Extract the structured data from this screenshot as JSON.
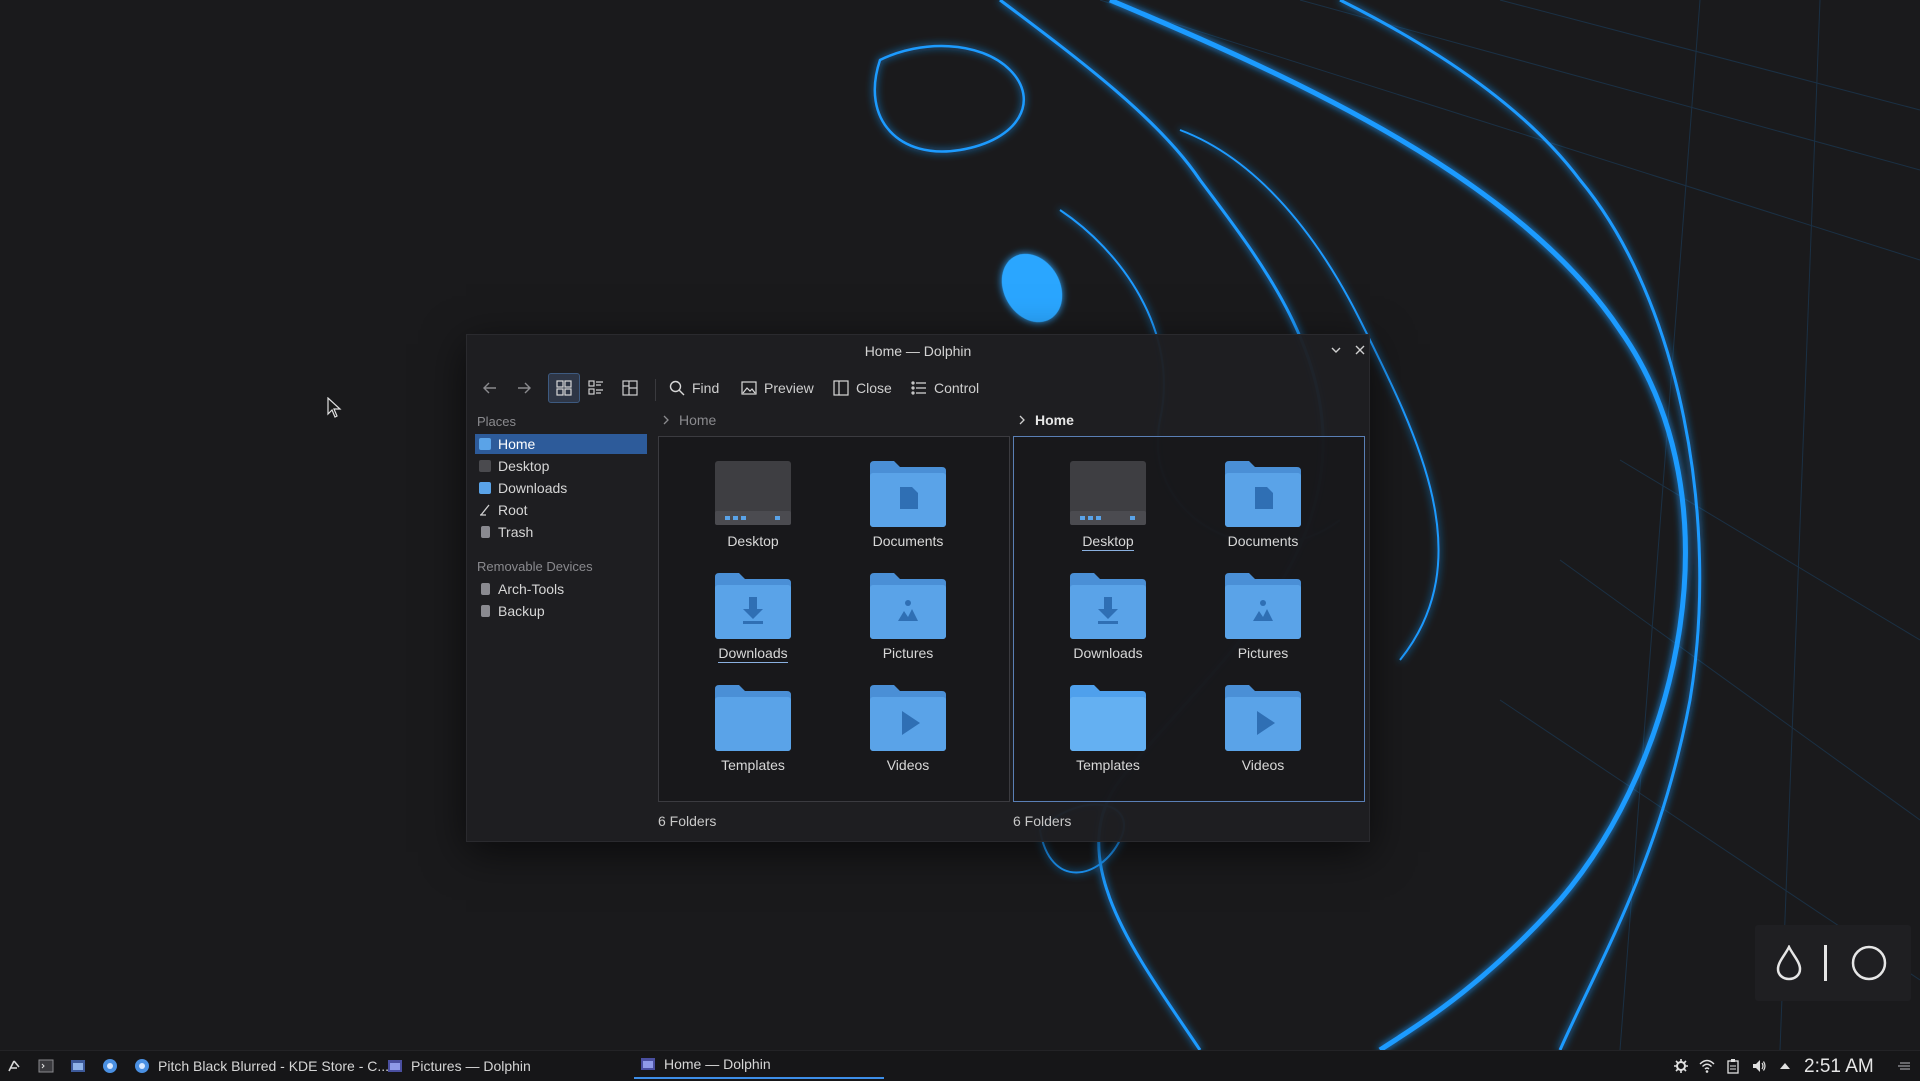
{
  "window": {
    "title": "Home — Dolphin",
    "controls": [
      "minimize-chevron",
      "close"
    ]
  },
  "toolbar": {
    "back_icon": "arrow-left",
    "forward_icon": "arrow-right",
    "view_modes": [
      "icons",
      "details",
      "compact"
    ],
    "active_view": "icons",
    "find_label": "Find",
    "preview_label": "Preview",
    "close_label": "Close",
    "control_label": "Control"
  },
  "sidebar": {
    "places_header": "Places",
    "places": [
      {
        "label": "Home",
        "icon": "home-folder",
        "active": true
      },
      {
        "label": "Desktop",
        "icon": "desktop"
      },
      {
        "label": "Downloads",
        "icon": "downloads-folder"
      },
      {
        "label": "Root",
        "icon": "root-slash"
      },
      {
        "label": "Trash",
        "icon": "trash"
      }
    ],
    "removable_header": "Removable Devices",
    "removable": [
      {
        "label": "Arch-Tools",
        "icon": "drive"
      },
      {
        "label": "Backup",
        "icon": "drive"
      }
    ]
  },
  "left_pane": {
    "breadcrumb": "Home",
    "items": [
      {
        "label": "Desktop",
        "icon": "desktop-folder"
      },
      {
        "label": "Documents",
        "icon": "documents-folder"
      },
      {
        "label": "Downloads",
        "icon": "downloads-folder",
        "underlined": true
      },
      {
        "label": "Pictures",
        "icon": "pictures-folder"
      },
      {
        "label": "Templates",
        "icon": "templates-folder"
      },
      {
        "label": "Videos",
        "icon": "videos-folder"
      }
    ],
    "status": "6 Folders"
  },
  "right_pane": {
    "breadcrumb": "Home",
    "items": [
      {
        "label": "Desktop",
        "icon": "desktop-folder",
        "underlined": true
      },
      {
        "label": "Documents",
        "icon": "documents-folder"
      },
      {
        "label": "Downloads",
        "icon": "downloads-folder"
      },
      {
        "label": "Pictures",
        "icon": "pictures-folder"
      },
      {
        "label": "Templates",
        "icon": "templates-folder"
      },
      {
        "label": "Videos",
        "icon": "videos-folder"
      }
    ],
    "status": "6 Folders"
  },
  "taskbar": {
    "tasks": [
      {
        "label": "Pitch Black Blurred - KDE Store - C...",
        "icon": "browser"
      },
      {
        "label": "Pictures — Dolphin",
        "icon": "dolphin"
      },
      {
        "label": "Home — Dolphin",
        "icon": "dolphin",
        "active": true
      }
    ],
    "launchers": [
      "app-launcher",
      "terminal",
      "file-manager",
      "browser"
    ],
    "tray": [
      "settings",
      "wifi",
      "clipboard",
      "volume",
      "expand-arrow",
      "panel-menu"
    ],
    "clock": "2:51 AM"
  },
  "colors": {
    "accent": "#3d8ee8",
    "selection": "#2d5b9a",
    "folder_blue": "#5aa3e8",
    "background": "#1a1a1c",
    "neon": "#1e9bff"
  }
}
